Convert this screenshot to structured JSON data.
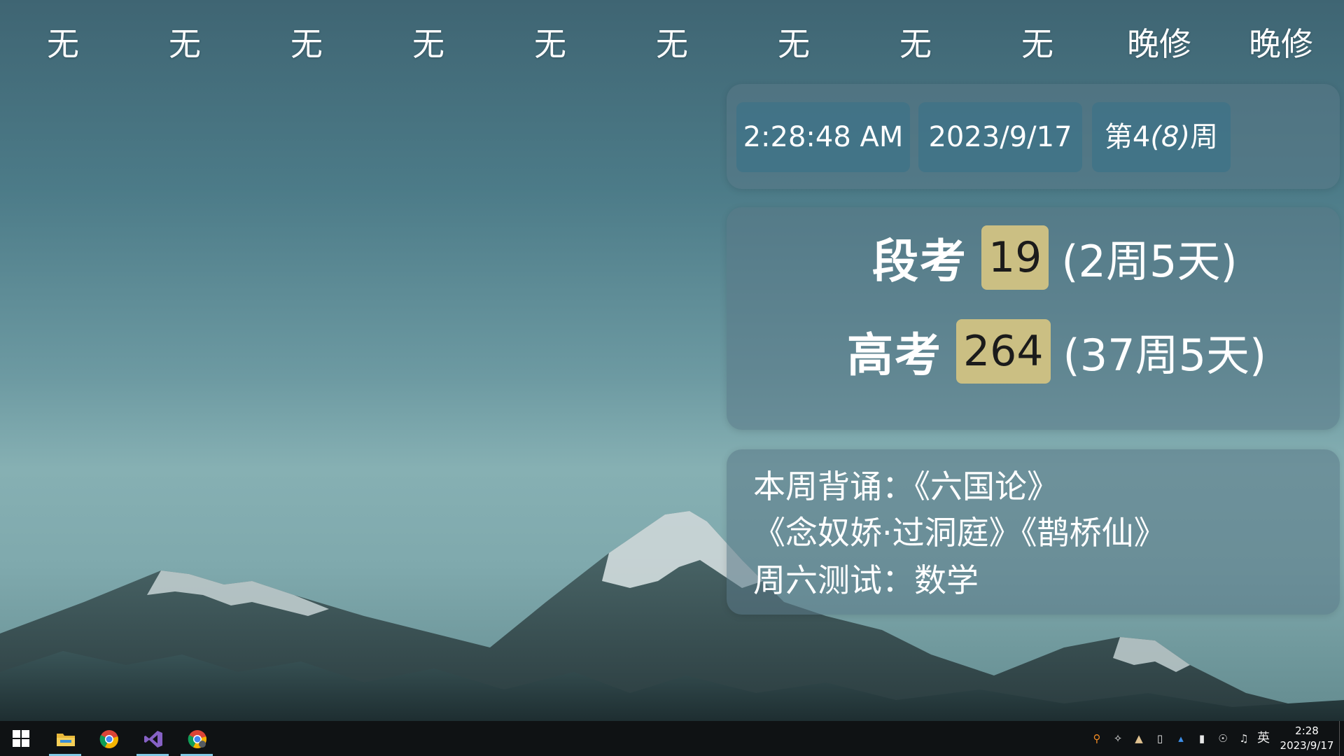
{
  "schedule": [
    "无",
    "无",
    "无",
    "无",
    "无",
    "无",
    "无",
    "无",
    "无",
    "晚修",
    "晚修"
  ],
  "time_panel": {
    "clock": "2:28:48 AM",
    "date": "2023/9/17",
    "week_prefix": "第4",
    "week_total": "(8)",
    "week_suffix": "周"
  },
  "countdowns": [
    {
      "label": "段考",
      "days": "19",
      "detail": "(2周5天)"
    },
    {
      "label": "高考",
      "days": "264",
      "detail": "(37周5天)"
    }
  ],
  "notes": {
    "line1": "本周背诵：《六国论》",
    "line2": "《念奴娇·过洞庭》《鹊桥仙》",
    "line3": "周六测试：数学"
  },
  "taskbar": {
    "apps": [
      {
        "name": "start-icon"
      },
      {
        "name": "file-explorer-icon"
      },
      {
        "name": "chrome-icon"
      },
      {
        "name": "visual-studio-icon"
      },
      {
        "name": "chrome-canary-icon"
      }
    ],
    "tray": {
      "language": "英",
      "time": "2:28",
      "date": "2023/9/17"
    }
  },
  "colors": {
    "badge": "#cbbf83",
    "chip": "#3f7387",
    "panel": "#5a7887",
    "taskbar": "#0f1214",
    "active_indicator": "#7fc7e3"
  }
}
